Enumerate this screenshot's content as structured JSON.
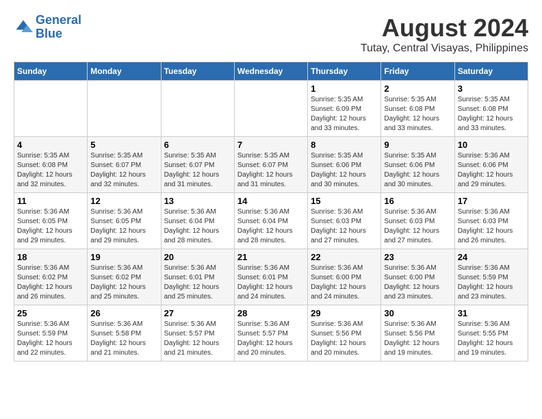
{
  "header": {
    "logo_line1": "General",
    "logo_line2": "Blue",
    "main_title": "August 2024",
    "sub_title": "Tutay, Central Visayas, Philippines"
  },
  "days_of_week": [
    "Sunday",
    "Monday",
    "Tuesday",
    "Wednesday",
    "Thursday",
    "Friday",
    "Saturday"
  ],
  "weeks": [
    [
      {
        "day": "",
        "info": ""
      },
      {
        "day": "",
        "info": ""
      },
      {
        "day": "",
        "info": ""
      },
      {
        "day": "",
        "info": ""
      },
      {
        "day": "1",
        "info": "Sunrise: 5:35 AM\nSunset: 6:09 PM\nDaylight: 12 hours\nand 33 minutes."
      },
      {
        "day": "2",
        "info": "Sunrise: 5:35 AM\nSunset: 6:08 PM\nDaylight: 12 hours\nand 33 minutes."
      },
      {
        "day": "3",
        "info": "Sunrise: 5:35 AM\nSunset: 6:08 PM\nDaylight: 12 hours\nand 33 minutes."
      }
    ],
    [
      {
        "day": "4",
        "info": "Sunrise: 5:35 AM\nSunset: 6:08 PM\nDaylight: 12 hours\nand 32 minutes."
      },
      {
        "day": "5",
        "info": "Sunrise: 5:35 AM\nSunset: 6:07 PM\nDaylight: 12 hours\nand 32 minutes."
      },
      {
        "day": "6",
        "info": "Sunrise: 5:35 AM\nSunset: 6:07 PM\nDaylight: 12 hours\nand 31 minutes."
      },
      {
        "day": "7",
        "info": "Sunrise: 5:35 AM\nSunset: 6:07 PM\nDaylight: 12 hours\nand 31 minutes."
      },
      {
        "day": "8",
        "info": "Sunrise: 5:35 AM\nSunset: 6:06 PM\nDaylight: 12 hours\nand 30 minutes."
      },
      {
        "day": "9",
        "info": "Sunrise: 5:35 AM\nSunset: 6:06 PM\nDaylight: 12 hours\nand 30 minutes."
      },
      {
        "day": "10",
        "info": "Sunrise: 5:36 AM\nSunset: 6:06 PM\nDaylight: 12 hours\nand 29 minutes."
      }
    ],
    [
      {
        "day": "11",
        "info": "Sunrise: 5:36 AM\nSunset: 6:05 PM\nDaylight: 12 hours\nand 29 minutes."
      },
      {
        "day": "12",
        "info": "Sunrise: 5:36 AM\nSunset: 6:05 PM\nDaylight: 12 hours\nand 29 minutes."
      },
      {
        "day": "13",
        "info": "Sunrise: 5:36 AM\nSunset: 6:04 PM\nDaylight: 12 hours\nand 28 minutes."
      },
      {
        "day": "14",
        "info": "Sunrise: 5:36 AM\nSunset: 6:04 PM\nDaylight: 12 hours\nand 28 minutes."
      },
      {
        "day": "15",
        "info": "Sunrise: 5:36 AM\nSunset: 6:03 PM\nDaylight: 12 hours\nand 27 minutes."
      },
      {
        "day": "16",
        "info": "Sunrise: 5:36 AM\nSunset: 6:03 PM\nDaylight: 12 hours\nand 27 minutes."
      },
      {
        "day": "17",
        "info": "Sunrise: 5:36 AM\nSunset: 6:03 PM\nDaylight: 12 hours\nand 26 minutes."
      }
    ],
    [
      {
        "day": "18",
        "info": "Sunrise: 5:36 AM\nSunset: 6:02 PM\nDaylight: 12 hours\nand 26 minutes."
      },
      {
        "day": "19",
        "info": "Sunrise: 5:36 AM\nSunset: 6:02 PM\nDaylight: 12 hours\nand 25 minutes."
      },
      {
        "day": "20",
        "info": "Sunrise: 5:36 AM\nSunset: 6:01 PM\nDaylight: 12 hours\nand 25 minutes."
      },
      {
        "day": "21",
        "info": "Sunrise: 5:36 AM\nSunset: 6:01 PM\nDaylight: 12 hours\nand 24 minutes."
      },
      {
        "day": "22",
        "info": "Sunrise: 5:36 AM\nSunset: 6:00 PM\nDaylight: 12 hours\nand 24 minutes."
      },
      {
        "day": "23",
        "info": "Sunrise: 5:36 AM\nSunset: 6:00 PM\nDaylight: 12 hours\nand 23 minutes."
      },
      {
        "day": "24",
        "info": "Sunrise: 5:36 AM\nSunset: 5:59 PM\nDaylight: 12 hours\nand 23 minutes."
      }
    ],
    [
      {
        "day": "25",
        "info": "Sunrise: 5:36 AM\nSunset: 5:59 PM\nDaylight: 12 hours\nand 22 minutes."
      },
      {
        "day": "26",
        "info": "Sunrise: 5:36 AM\nSunset: 5:58 PM\nDaylight: 12 hours\nand 21 minutes."
      },
      {
        "day": "27",
        "info": "Sunrise: 5:36 AM\nSunset: 5:57 PM\nDaylight: 12 hours\nand 21 minutes."
      },
      {
        "day": "28",
        "info": "Sunrise: 5:36 AM\nSunset: 5:57 PM\nDaylight: 12 hours\nand 20 minutes."
      },
      {
        "day": "29",
        "info": "Sunrise: 5:36 AM\nSunset: 5:56 PM\nDaylight: 12 hours\nand 20 minutes."
      },
      {
        "day": "30",
        "info": "Sunrise: 5:36 AM\nSunset: 5:56 PM\nDaylight: 12 hours\nand 19 minutes."
      },
      {
        "day": "31",
        "info": "Sunrise: 5:36 AM\nSunset: 5:55 PM\nDaylight: 12 hours\nand 19 minutes."
      }
    ]
  ]
}
